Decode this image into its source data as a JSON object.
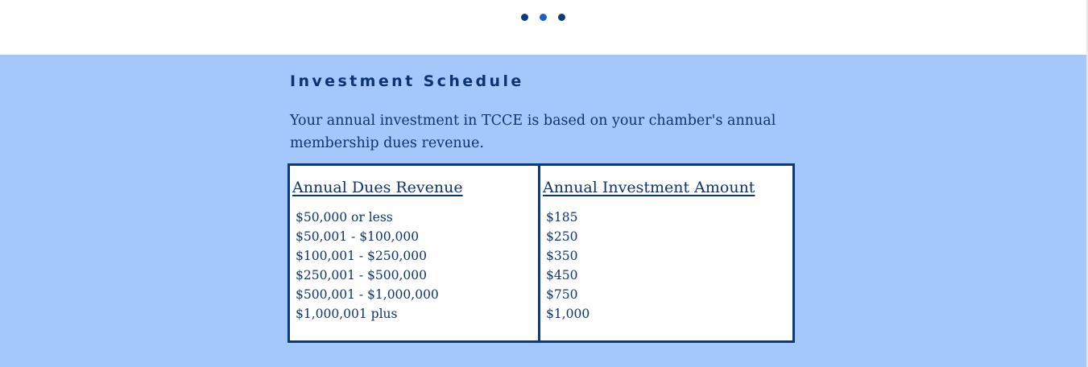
{
  "carousel": {
    "dot_count": 3,
    "active_index": 1,
    "colors": {
      "dot": "#0b3a7e",
      "active": "#1560d0"
    }
  },
  "section": {
    "heading": "Investment Schedule",
    "intro": "Your annual investment in TCCE is based on your chamber's annual membership dues revenue.",
    "background": "#a4c8fb"
  },
  "schedule": {
    "border_color": "#0b3a7e",
    "headers": [
      "Annual Dues Revenue",
      "Annual Investment Amount"
    ],
    "revenue": [
      "$50,000 or less",
      "$50,001 - $100,000",
      "$100,001 - $250,000",
      "$250,001 - $500,000",
      "$500,001 - $1,000,000",
      "$1,000,001 plus"
    ],
    "amount": [
      "$185",
      "$250",
      "$350",
      "$450",
      "$750",
      "$1,000"
    ]
  }
}
